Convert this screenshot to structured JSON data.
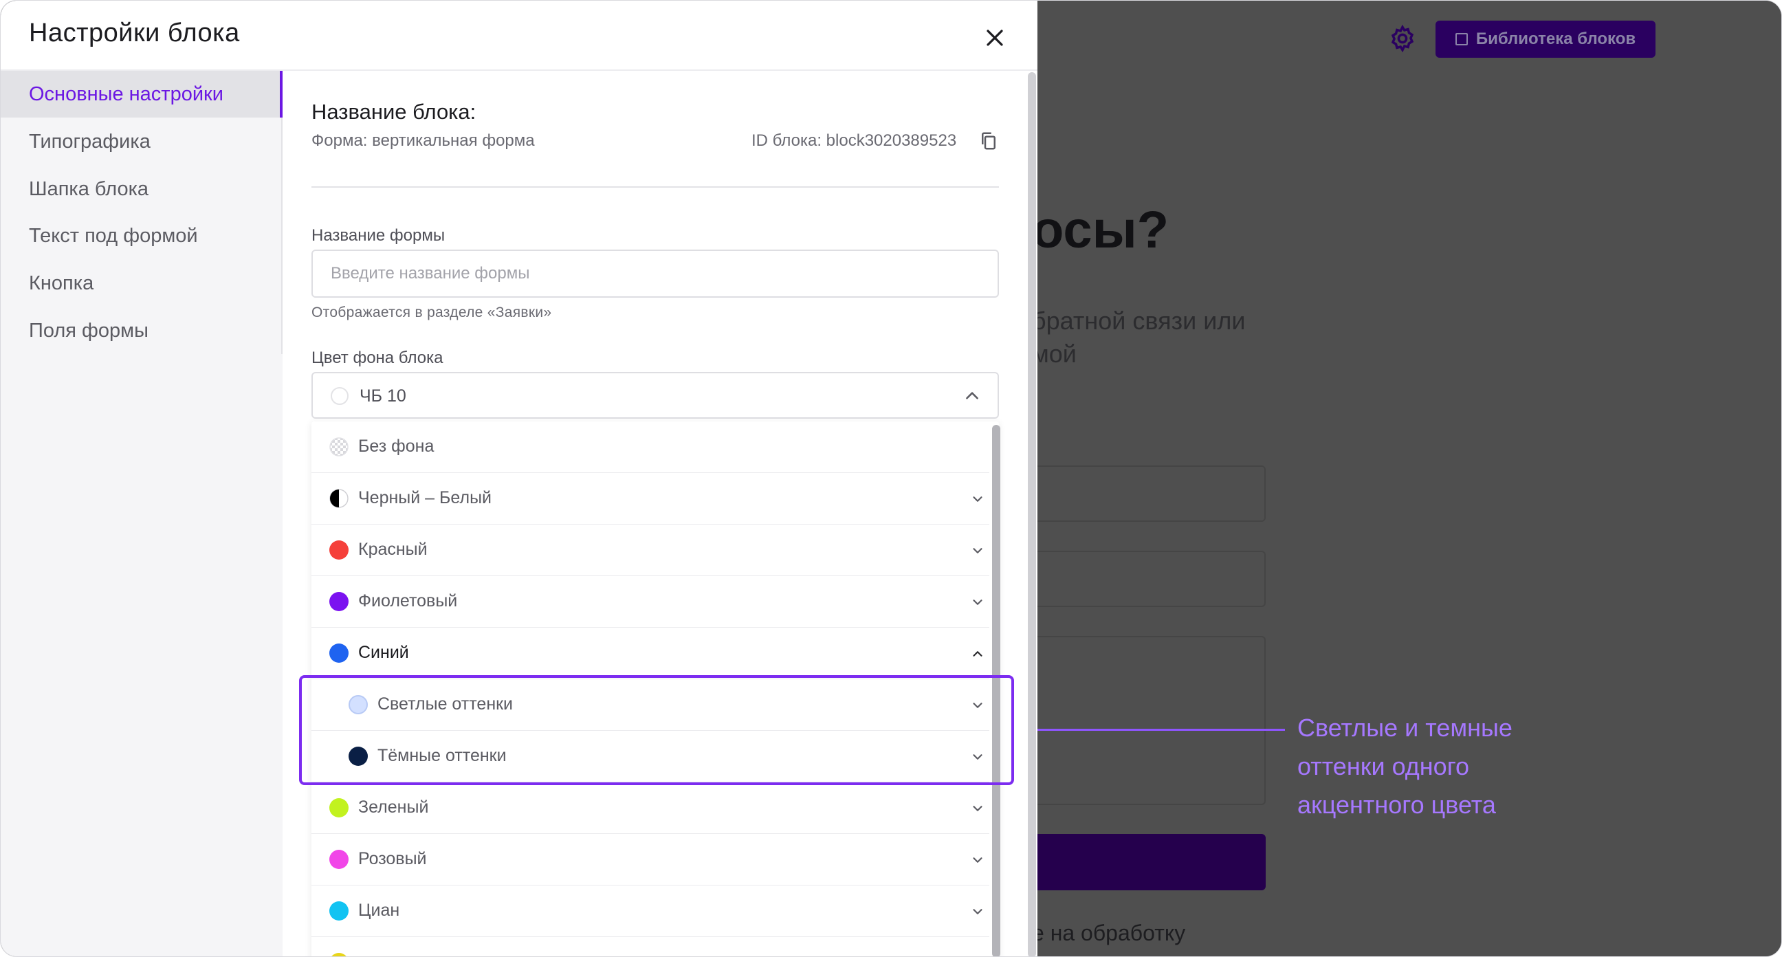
{
  "background": {
    "library_button": "Библиотека блоков",
    "heading": "осы?",
    "sub_line1": "братной связи или",
    "sub_line2": "мой",
    "consent": "е на обработку"
  },
  "callout": {
    "line1": "Светлые и темные",
    "line2": "оттенки одного",
    "line3": "акцентного цвета",
    "color": "#a678ff"
  },
  "panel": {
    "title": "Настройки блока",
    "close_icon": "close-icon"
  },
  "sidebar": {
    "items": [
      {
        "label": "Основные настройки",
        "active": true
      },
      {
        "label": "Типографика"
      },
      {
        "label": "Шапка блока"
      },
      {
        "label": "Текст под формой"
      },
      {
        "label": "Кнопка"
      },
      {
        "label": "Поля формы"
      }
    ]
  },
  "content": {
    "block_title": "Название блока:",
    "form_type": "Форма: вертикальная форма",
    "block_id": "ID блока: block3020389523",
    "form_name_label": "Название формы",
    "form_name_placeholder": "Введите название формы",
    "form_name_value": "",
    "form_name_hint": "Отображается в разделе «Заявки»",
    "bg_color_label": "Цвет фона блока",
    "bg_color_value": "ЧБ 10"
  },
  "dropdown": {
    "items": [
      {
        "label": "Без фона",
        "color": "pattern"
      },
      {
        "label": "Черный – Белый",
        "color": "#000000"
      },
      {
        "label": "Красный",
        "color": "#f5403a"
      },
      {
        "label": "Фиолетовый",
        "color": "#7b12f0"
      },
      {
        "label": "Синий",
        "color": "#1f63f0"
      },
      {
        "label": "Светлые оттенки",
        "color": "#d3e0ff"
      },
      {
        "label": "Тёмные оттенки",
        "color": "#0a1f45"
      },
      {
        "label": "Зеленый",
        "color": "#c2f21f"
      },
      {
        "label": "Розовый",
        "color": "#f146e8"
      },
      {
        "label": "Циан",
        "color": "#12c3f2"
      }
    ]
  },
  "colors": {
    "accent": "#6b17e3",
    "highlight": "#7c2cf0",
    "library_button_bg": "#2a0060"
  }
}
